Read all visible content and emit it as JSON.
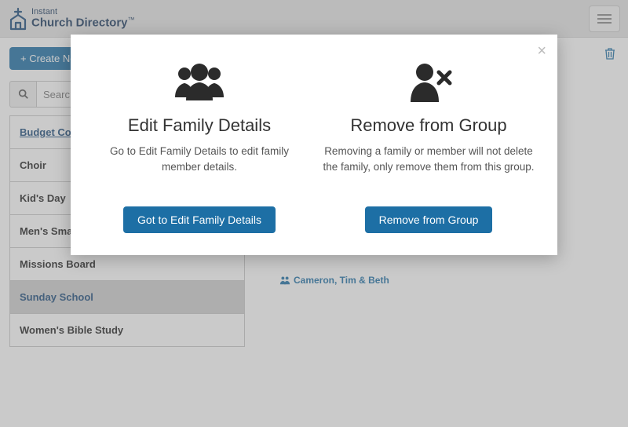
{
  "logo": {
    "line1": "Instant",
    "line2": "Church Directory",
    "tm": "™"
  },
  "toolbar": {
    "create_label": "+ Create Ne"
  },
  "search": {
    "placeholder": "Searc"
  },
  "groups": [
    {
      "label": "Budget Co",
      "link": true,
      "selected": false
    },
    {
      "label": "Choir",
      "link": false,
      "selected": false
    },
    {
      "label": "Kid's Day",
      "link": false,
      "selected": false
    },
    {
      "label": "Men's Sma",
      "link": false,
      "selected": false
    },
    {
      "label": "Missions Board",
      "link": false,
      "selected": false
    },
    {
      "label": "Sunday School",
      "link": false,
      "selected": true
    },
    {
      "label": "Women's Bible Study",
      "link": false,
      "selected": false
    }
  ],
  "member": {
    "name": "Cameron, Tim & Beth"
  },
  "modal": {
    "edit": {
      "title": "Edit Family Details",
      "desc": "Go to Edit Family Details to edit family member details.",
      "button": "Got to Edit Family Details"
    },
    "remove": {
      "title": "Remove from Group",
      "desc": "Removing a family or member will not delete the family, only remove them from this group.",
      "button": "Remove from Group"
    }
  }
}
